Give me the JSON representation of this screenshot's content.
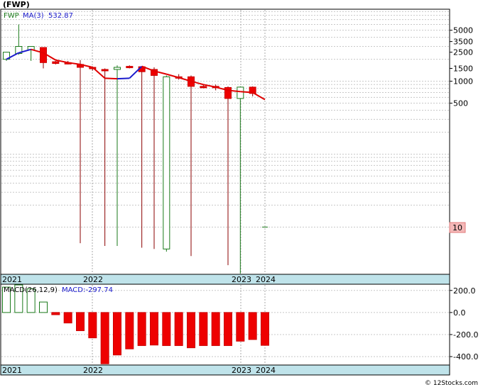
{
  "chart_data": [
    {
      "type": "candlestick",
      "title": "(FWP)",
      "legend": [
        {
          "label": "FWP",
          "color": "#1a7a1a"
        },
        {
          "label": "MA(3)",
          "color": "#1a1acc"
        },
        {
          "label": "532.87",
          "color": "#1a1acc"
        }
      ],
      "y_scale": "log",
      "ylim": [
        2.3,
        9500
      ],
      "y_ticks": [
        "5000",
        "3500",
        "2500",
        "1500",
        "1000",
        "500"
      ],
      "price_tag": "10",
      "x_labels": [
        "2021",
        "2022",
        "2023",
        "2024"
      ],
      "candles": [
        {
          "o": 2000,
          "h": 2500,
          "l": 1900,
          "c": 2500,
          "up": true
        },
        {
          "o": 2400,
          "h": 6000,
          "l": 2300,
          "c": 3000,
          "up": true
        },
        {
          "o": 2700,
          "h": 3000,
          "l": 1900,
          "c": 3000,
          "up": true
        },
        {
          "o": 2900,
          "h": 2900,
          "l": 1500,
          "c": 1800,
          "up": false
        },
        {
          "o": 1850,
          "h": 1900,
          "l": 1700,
          "c": 1750,
          "up": false
        },
        {
          "o": 1800,
          "h": 1900,
          "l": 1700,
          "c": 1750,
          "up": false
        },
        {
          "o": 1700,
          "h": 1950,
          "l": 6,
          "c": 1550,
          "up": false
        },
        {
          "o": 1550,
          "h": 1600,
          "l": 1400,
          "c": 1500,
          "up": false
        },
        {
          "o": 1450,
          "h": 1500,
          "l": 5.5,
          "c": 1400,
          "up": false
        },
        {
          "o": 1450,
          "h": 1650,
          "l": 5.5,
          "c": 1550,
          "up": true
        },
        {
          "o": 1600,
          "h": 1650,
          "l": 1500,
          "c": 1580,
          "up": false
        },
        {
          "o": 1580,
          "h": 1600,
          "l": 5.2,
          "c": 1350,
          "up": false
        },
        {
          "o": 1450,
          "h": 1550,
          "l": 5,
          "c": 1200,
          "up": false
        },
        {
          "o": 5,
          "h": 1200,
          "l": 4.6,
          "c": 1150,
          "up": true
        },
        {
          "o": 1150,
          "h": 1250,
          "l": 1050,
          "c": 1120,
          "up": false
        },
        {
          "o": 1150,
          "h": 1200,
          "l": 4,
          "c": 850,
          "up": false
        },
        {
          "o": 850,
          "h": 900,
          "l": 800,
          "c": 820,
          "up": false
        },
        {
          "o": 850,
          "h": 900,
          "l": 750,
          "c": 820,
          "up": false
        },
        {
          "o": 820,
          "h": 850,
          "l": 3,
          "c": 580,
          "up": false
        },
        {
          "o": 580,
          "h": 850,
          "l": 2.3,
          "c": 830,
          "up": true
        },
        {
          "o": 830,
          "h": 850,
          "l": 620,
          "c": 680,
          "up": false
        },
        {
          "o": 10,
          "h": 10,
          "l": 10,
          "c": 10,
          "up": false
        }
      ],
      "ma3": [
        2000,
        2450,
        2730,
        2450,
        1950,
        1800,
        1700,
        1550,
        1100,
        1080,
        1100,
        1600,
        1380,
        1250,
        1120,
        1000,
        900,
        830,
        750,
        720,
        700,
        560
      ]
    },
    {
      "type": "bar",
      "title": "MACD(26,12,9)",
      "value_label": "MACD:-297.74",
      "y_ticks": [
        "200.0",
        "0.0",
        "-200.0",
        "-400.0"
      ],
      "ylim": [
        -470,
        250
      ],
      "x_labels": [
        "2021",
        "2022",
        "2023",
        "2024"
      ],
      "values": [
        230,
        250,
        215,
        95,
        -20,
        -95,
        -165,
        -230,
        -465,
        -385,
        -330,
        -300,
        -295,
        -300,
        -300,
        -320,
        -300,
        -300,
        -300,
        -260,
        -245,
        -297.74
      ]
    }
  ],
  "footer": {
    "credit": "© 12Stocks.com"
  }
}
